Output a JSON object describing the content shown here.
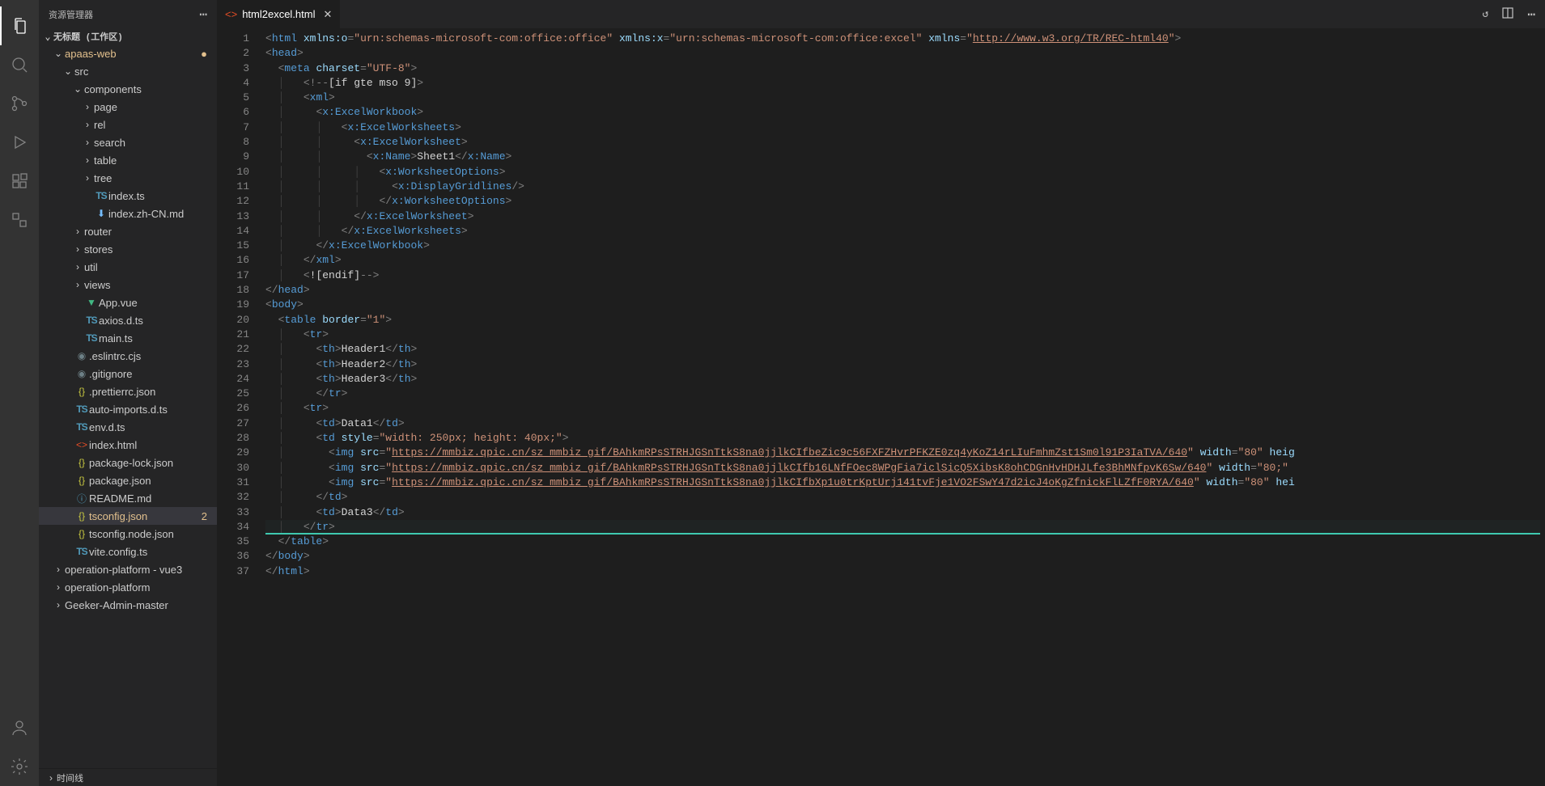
{
  "sidebar": {
    "title": "资源管理器",
    "workspace": "无标题 (工作区)",
    "timeline": "时间线",
    "tree": [
      {
        "depth": 1,
        "twisty": "v",
        "type": "folder",
        "label": "apaas-web",
        "modMark": "●",
        "modColor": "#e2c08d"
      },
      {
        "depth": 2,
        "twisty": "v",
        "type": "folder",
        "label": "src"
      },
      {
        "depth": 3,
        "twisty": "v",
        "type": "folder",
        "label": "components"
      },
      {
        "depth": 4,
        "twisty": ">",
        "type": "folder",
        "label": "page"
      },
      {
        "depth": 4,
        "twisty": ">",
        "type": "folder",
        "label": "rel"
      },
      {
        "depth": 4,
        "twisty": ">",
        "type": "folder",
        "label": "search"
      },
      {
        "depth": 4,
        "twisty": ">",
        "type": "folder",
        "label": "table"
      },
      {
        "depth": 4,
        "twisty": ">",
        "type": "folder",
        "label": "tree"
      },
      {
        "depth": 4,
        "twisty": " ",
        "type": "ts",
        "label": "index.ts"
      },
      {
        "depth": 4,
        "twisty": " ",
        "type": "download",
        "label": "index.zh-CN.md"
      },
      {
        "depth": 3,
        "twisty": ">",
        "type": "folder",
        "label": "router"
      },
      {
        "depth": 3,
        "twisty": ">",
        "type": "folder",
        "label": "stores"
      },
      {
        "depth": 3,
        "twisty": ">",
        "type": "folder",
        "label": "util"
      },
      {
        "depth": 3,
        "twisty": ">",
        "type": "folder",
        "label": "views"
      },
      {
        "depth": 3,
        "twisty": " ",
        "type": "vue",
        "label": "App.vue"
      },
      {
        "depth": 3,
        "twisty": " ",
        "type": "ts",
        "label": "axios.d.ts"
      },
      {
        "depth": 3,
        "twisty": " ",
        "type": "ts",
        "label": "main.ts"
      },
      {
        "depth": 2,
        "twisty": " ",
        "type": "config",
        "label": ".eslintrc.cjs"
      },
      {
        "depth": 2,
        "twisty": " ",
        "type": "config",
        "label": ".gitignore"
      },
      {
        "depth": 2,
        "twisty": " ",
        "type": "json",
        "label": ".prettierrc.json"
      },
      {
        "depth": 2,
        "twisty": " ",
        "type": "ts",
        "label": "auto-imports.d.ts"
      },
      {
        "depth": 2,
        "twisty": " ",
        "type": "ts",
        "label": "env.d.ts"
      },
      {
        "depth": 2,
        "twisty": " ",
        "type": "html",
        "label": "index.html"
      },
      {
        "depth": 2,
        "twisty": " ",
        "type": "json",
        "label": "package-lock.json"
      },
      {
        "depth": 2,
        "twisty": " ",
        "type": "json",
        "label": "package.json"
      },
      {
        "depth": 2,
        "twisty": " ",
        "type": "md",
        "label": "README.md"
      },
      {
        "depth": 2,
        "twisty": " ",
        "type": "json",
        "label": "tsconfig.json",
        "selected": true,
        "badge": "2"
      },
      {
        "depth": 2,
        "twisty": " ",
        "type": "json",
        "label": "tsconfig.node.json"
      },
      {
        "depth": 2,
        "twisty": " ",
        "type": "ts",
        "label": "vite.config.ts"
      },
      {
        "depth": 1,
        "twisty": ">",
        "type": "folder",
        "label": "operation-platform - vue3"
      },
      {
        "depth": 1,
        "twisty": ">",
        "type": "folder",
        "label": "operation-platform"
      },
      {
        "depth": 1,
        "twisty": ">",
        "type": "folder",
        "label": "Geeker-Admin-master"
      }
    ]
  },
  "tab": {
    "label": "html2excel.html"
  },
  "code": {
    "lineStart": 1,
    "lineEnd": 37,
    "highlightLine": 34,
    "attrs": {
      "xmlns_o": "urn:schemas-microsoft-com:office:office",
      "xmlns_x": "urn:schemas-microsoft-com:office:excel",
      "xmlns": "http://www.w3.org/TR/REC-html40",
      "charset": "UTF-8",
      "border": "1",
      "td_style": "width: 250px; height: 40px;",
      "img1": "https://mmbiz.qpic.cn/sz_mmbiz_gif/BAhkmRPsSTRHJGSnTtkS8na0jjlkCIfbeZic9c56FXFZHvrPFKZE0zq4yKoZ14rLIuFmhmZst1Sm0l91P3IaTVA/640",
      "img2": "https://mmbiz.qpic.cn/sz_mmbiz_gif/BAhkmRPsSTRHJGSnTtkS8na0jjlkCIfb16LNfFOec8WPgFia7iclSicQ5XibsK8ohCDGnHvHDHJLfe3BhMNfpvK6Sw/640",
      "img3": "https://mmbiz.qpic.cn/sz_mmbiz_gif/BAhkmRPsSTRHJGSnTtkS8na0jjlkCIfbXp1u0trKptUrj141tvFje1VO2FSwY47d2icJ4oKgZfnickFlLZfF0RYA/640",
      "width": "80"
    },
    "text": {
      "sheetName": "Sheet1",
      "h1": "Header1",
      "h2": "Header2",
      "h3": "Header3",
      "d1": "Data1",
      "d3": "Data3"
    }
  }
}
